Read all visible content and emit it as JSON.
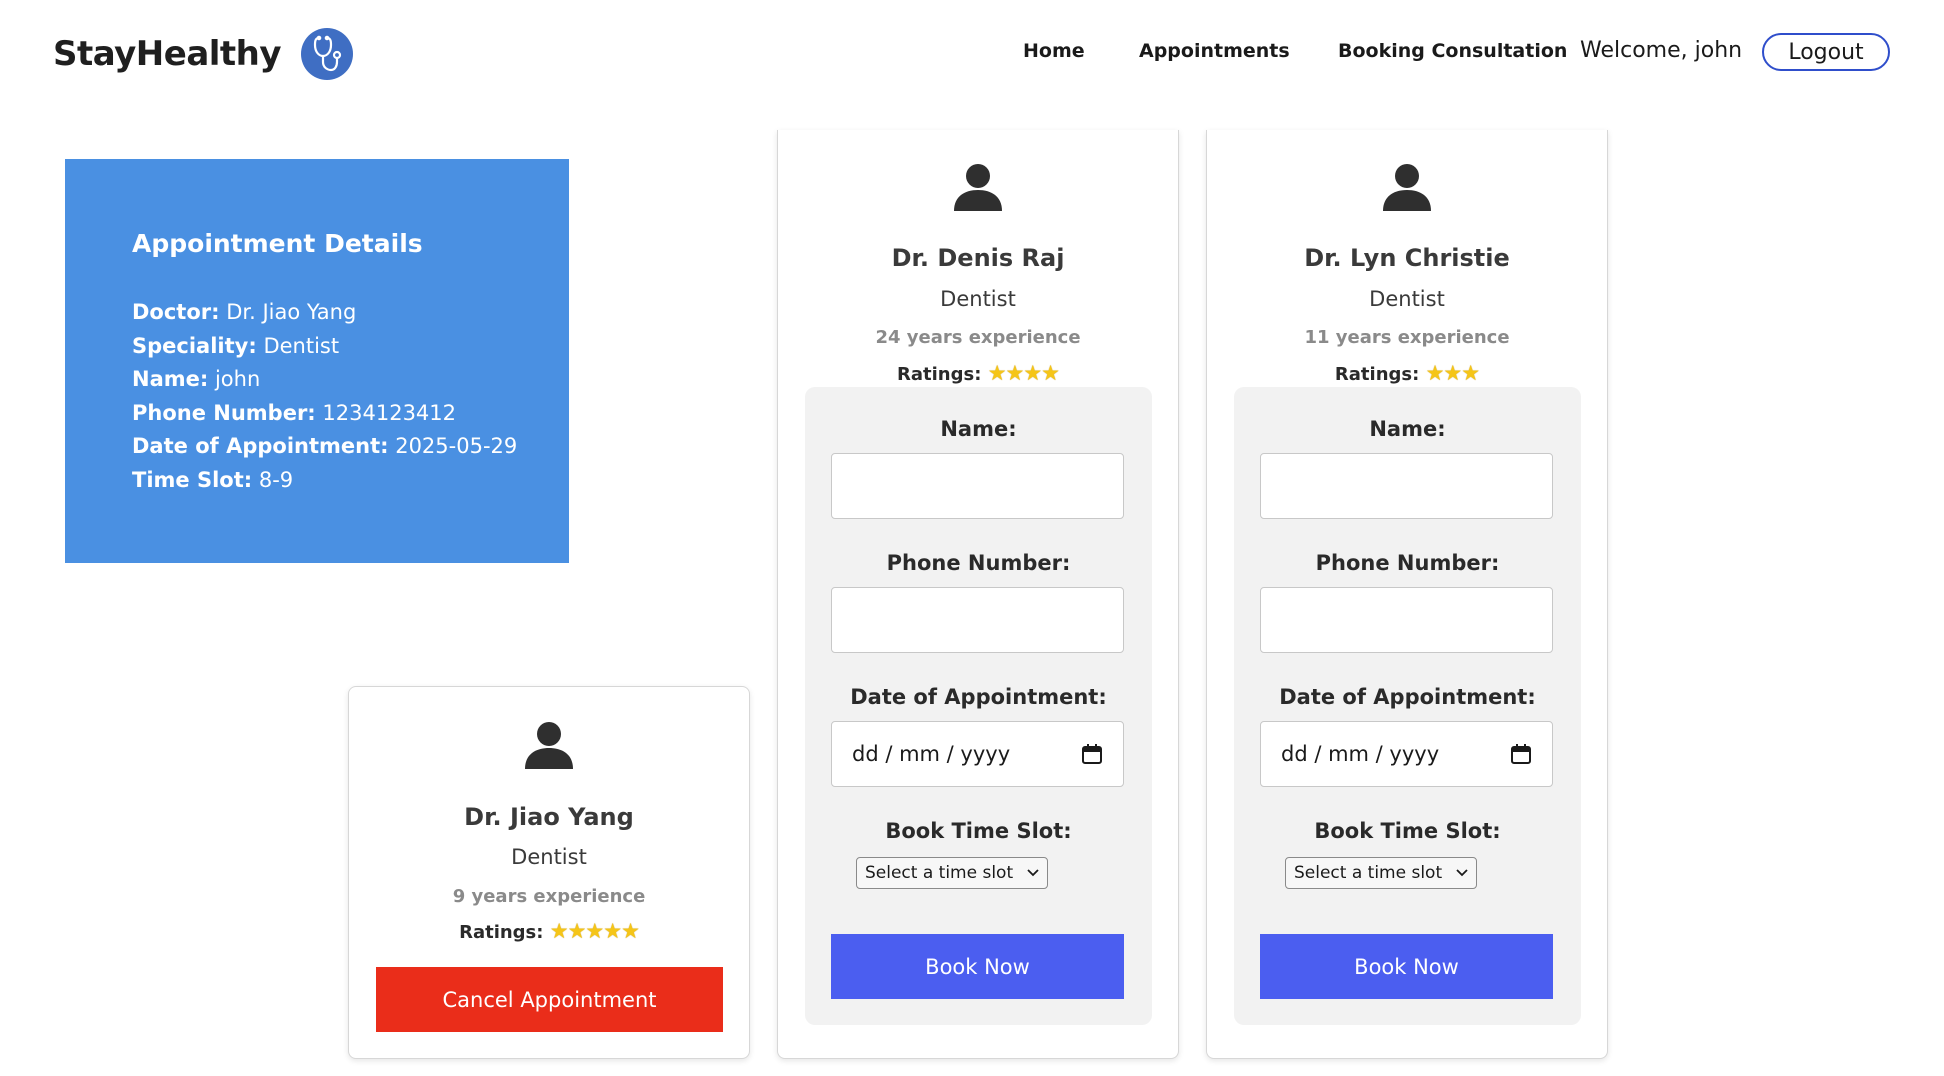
{
  "header": {
    "brand": "StayHealthy",
    "nav": [
      "Home",
      "Appointments",
      "Booking Consultation"
    ],
    "welcome": "Welcome, john",
    "logout": "Logout"
  },
  "appointment_details": {
    "title": "Appointment Details",
    "rows": [
      {
        "label": "Doctor:",
        "value": "Dr. Jiao Yang"
      },
      {
        "label": "Speciality:",
        "value": "Dentist"
      },
      {
        "label": "Name:",
        "value": "john"
      },
      {
        "label": "Phone Number:",
        "value": "1234123412"
      },
      {
        "label": "Date of Appointment:",
        "value": "2025-05-29"
      },
      {
        "label": "Time Slot:",
        "value": "8-9"
      }
    ]
  },
  "colors": {
    "details_bg": "#4a90e2",
    "cancel": "#ea2d1a",
    "book": "#4b5ef0",
    "logout_border": "#2f4ecb"
  },
  "doctors": [
    {
      "name": "Dr. Jiao Yang",
      "speciality": "Dentist",
      "experience": "9 years experience",
      "ratings_label": "Ratings:",
      "stars": "★★★★★",
      "rating": 5,
      "action": "Cancel Appointment"
    },
    {
      "name": "Dr. Denis Raj",
      "speciality": "Dentist",
      "experience": "24 years experience",
      "ratings_label": "Ratings:",
      "stars": "★★★★",
      "rating": 4,
      "form": {
        "name_label": "Name:",
        "name_value": "",
        "phone_label": "Phone Number:",
        "phone_value": "",
        "date_label": "Date of Appointment:",
        "date_placeholder": "dd / mm / yyyy",
        "slot_label": "Book Time Slot:",
        "slot_selected": "Select a time slot",
        "submit": "Book Now"
      }
    },
    {
      "name": "Dr. Lyn Christie",
      "speciality": "Dentist",
      "experience": "11 years experience",
      "ratings_label": "Ratings:",
      "stars": "★★★",
      "rating": 3,
      "form": {
        "name_label": "Name:",
        "name_value": "",
        "phone_label": "Phone Number:",
        "phone_value": "",
        "date_label": "Date of Appointment:",
        "date_placeholder": "dd / mm / yyyy",
        "slot_label": "Book Time Slot:",
        "slot_selected": "Select a time slot",
        "submit": "Book Now"
      }
    }
  ]
}
